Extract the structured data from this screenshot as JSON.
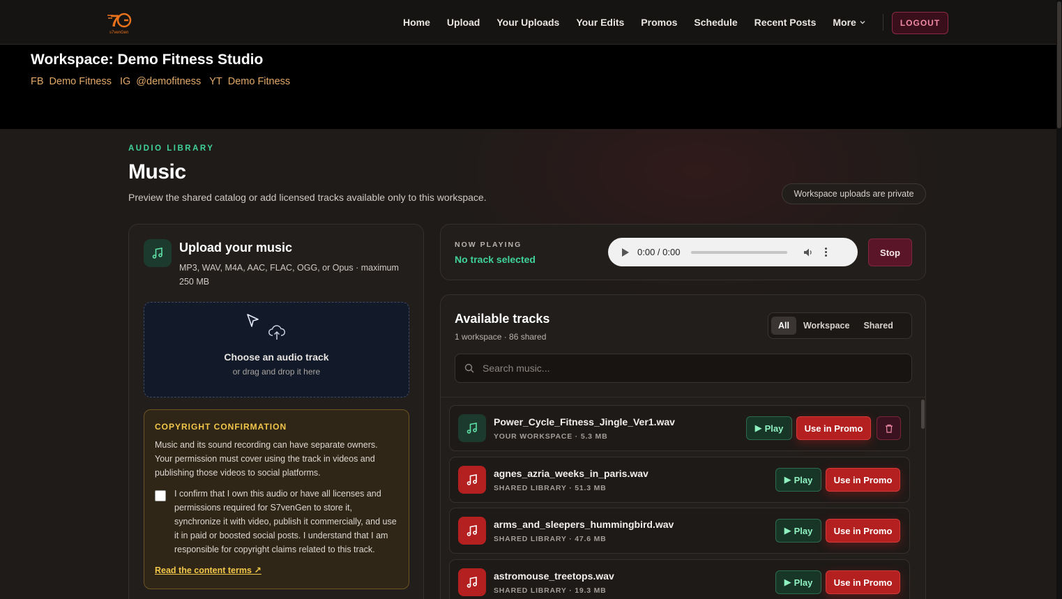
{
  "nav": {
    "logo_alt": "s7venGen",
    "links": [
      "Home",
      "Upload",
      "Your Uploads",
      "Your Edits",
      "Promos",
      "Schedule",
      "Recent Posts"
    ],
    "more_label": "More",
    "logout_label": "LOGOUT"
  },
  "workspace": {
    "title": "Workspace: Demo Fitness Studio",
    "socials": [
      {
        "tag": "FB",
        "name": "Demo Fitness"
      },
      {
        "tag": "IG",
        "name": "@demofitness"
      },
      {
        "tag": "YT",
        "name": "Demo Fitness"
      }
    ]
  },
  "page": {
    "eyebrow": "AUDIO LIBRARY",
    "title": "Music",
    "description": "Preview the shared catalog or add licensed tracks available only to this workspace.",
    "private_note": "Workspace uploads are private"
  },
  "upload": {
    "title": "Upload your music",
    "subtitle": "MP3, WAV, M4A, AAC, FLAC, OGG, or Opus · maximum 250 MB",
    "drop_title": "Choose an audio track",
    "drop_sub": "or drag and drop it here",
    "copyright": {
      "title": "COPYRIGHT CONFIRMATION",
      "body": "Music and its sound recording can have separate owners. Your permission must cover using the track in videos and publishing those videos to social platforms.",
      "confirm": "I confirm that I own this audio or have all licenses and permissions required for S7venGen to store it, synchronize it with video, publish it commercially, and use it in paid or boosted social posts. I understand that I am responsible for copyright claims related to this track.",
      "link": "Read the content terms ↗"
    }
  },
  "now_playing": {
    "label": "NOW PLAYING",
    "value": "No track selected",
    "time": "0:00 / 0:00",
    "stop_label": "Stop"
  },
  "tracks": {
    "title": "Available tracks",
    "subtitle": "1 workspace · 86 shared",
    "filters": [
      "All",
      "Workspace",
      "Shared"
    ],
    "active_filter": "All",
    "search_placeholder": "Search music...",
    "play_label": "Play",
    "promo_label": "Use in Promo",
    "items": [
      {
        "name": "Power_Cycle_Fitness_Jingle_Ver1.wav",
        "meta": "YOUR WORKSPACE · 5.3 MB",
        "source": "workspace"
      },
      {
        "name": "agnes_azria_weeks_in_paris.wav",
        "meta": "SHARED LIBRARY · 51.3 MB",
        "source": "shared"
      },
      {
        "name": "arms_and_sleepers_hummingbird.wav",
        "meta": "SHARED LIBRARY · 47.6 MB",
        "source": "shared"
      },
      {
        "name": "astromouse_treetops.wav",
        "meta": "SHARED LIBRARY · 19.3 MB",
        "source": "shared"
      }
    ]
  },
  "colors": {
    "accent_green": "#3fd39a",
    "accent_red": "#b3201f",
    "accent_gold": "#f3c74a",
    "social_orange": "#e2a969"
  }
}
